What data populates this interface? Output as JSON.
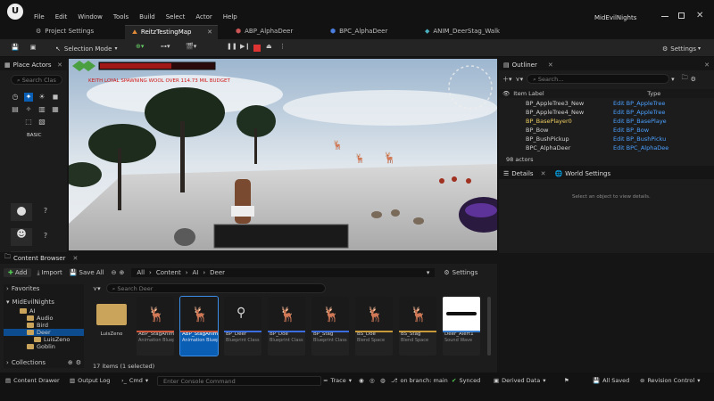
{
  "menu": [
    "File",
    "Edit",
    "Window",
    "Tools",
    "Build",
    "Select",
    "Actor",
    "Help"
  ],
  "project_name": "MidEvilNights",
  "tabs": [
    "Project Settings",
    "ReitzTestingMap",
    "ABP_AlphaDeer",
    "BPC_AlphaDeer",
    "ANIM_DeerStag_Walk"
  ],
  "toolbar": {
    "selection_mode": "Selection Mode",
    "settings": "Settings"
  },
  "place_actors": {
    "title": "Place Actors",
    "search_placeholder": "Search Clas",
    "basic_label": "BASIC"
  },
  "viewport": {
    "debug_text": "KEITH LOYAL SPAWNING WOOL OVER 114.73 MIL BUDGET"
  },
  "outliner": {
    "title": "Outliner",
    "search_placeholder": "Search...",
    "col_label": "Item Label",
    "col_type": "Type",
    "rows": [
      {
        "label": "BP_AppleTree3_New",
        "type": "Edit BP_AppleTree"
      },
      {
        "label": "BP_AppleTree4_New",
        "type": "Edit BP_AppleTree"
      },
      {
        "label": "BP_BasePlayer0",
        "type": "Edit BP_BasePlaye"
      },
      {
        "label": "BP_Bow",
        "type": "Edit BP_Bow"
      },
      {
        "label": "BP_BushPickup",
        "type": "Edit BP_BushPicku"
      },
      {
        "label": "BPC_AlphaDeer",
        "type": "Edit BPC_AlphaDee"
      }
    ],
    "actor_count": "98 actors"
  },
  "details": {
    "title": "Details",
    "world_settings": "World Settings",
    "empty_msg": "Select an object to view details."
  },
  "content_browser": {
    "title": "Content Browser",
    "add": "Add",
    "import": "Import",
    "save_all": "Save All",
    "path": [
      "All",
      "Content",
      "AI",
      "Deer"
    ],
    "settings": "Settings",
    "favorites": "Favorites",
    "root": "MidEvilNights",
    "tree": [
      "AI",
      "Audio",
      "Bird",
      "Deer",
      "LuisZeno",
      "Goblin"
    ],
    "collections": "Collections",
    "search_placeholder": "Search Deer",
    "assets": [
      {
        "name": "LuisZeno",
        "type": "",
        "color": "#caa45a"
      },
      {
        "name": "ABP_StagAnim",
        "type": "Animation Blueprint",
        "color": "#d0573b"
      },
      {
        "name": "ABP_StagAnim",
        "type": "Animation Blueprint",
        "color": "#d0573b"
      },
      {
        "name": "BP_Deer",
        "type": "Blueprint Class",
        "color": "#3c6de0"
      },
      {
        "name": "BP_Doe",
        "type": "Blueprint Class",
        "color": "#3c6de0"
      },
      {
        "name": "BP_Stag",
        "type": "Blueprint Class",
        "color": "#3c6de0"
      },
      {
        "name": "BS_Doe",
        "type": "Blend Space",
        "color": "#c89a3a"
      },
      {
        "name": "BS_Stag",
        "type": "Blend Space",
        "color": "#c89a3a"
      },
      {
        "name": "Deer_Alert1",
        "type": "Sound Wave",
        "color": "#3a7fd0"
      }
    ],
    "status": "17 items (1 selected)"
  },
  "statusbar": {
    "content_drawer": "Content Drawer",
    "output_log": "Output Log",
    "cmd": "Cmd",
    "console_placeholder": "Enter Console Command",
    "trace": "Trace",
    "branch": "on branch: main",
    "synced": "Synced",
    "derived_data": "Derived Data",
    "all_saved": "All Saved",
    "revision_control": "Revision Control"
  },
  "colors": {
    "accent": "#0070e0",
    "selected": "#0d4d8f",
    "bg": "#1c1c1c"
  }
}
